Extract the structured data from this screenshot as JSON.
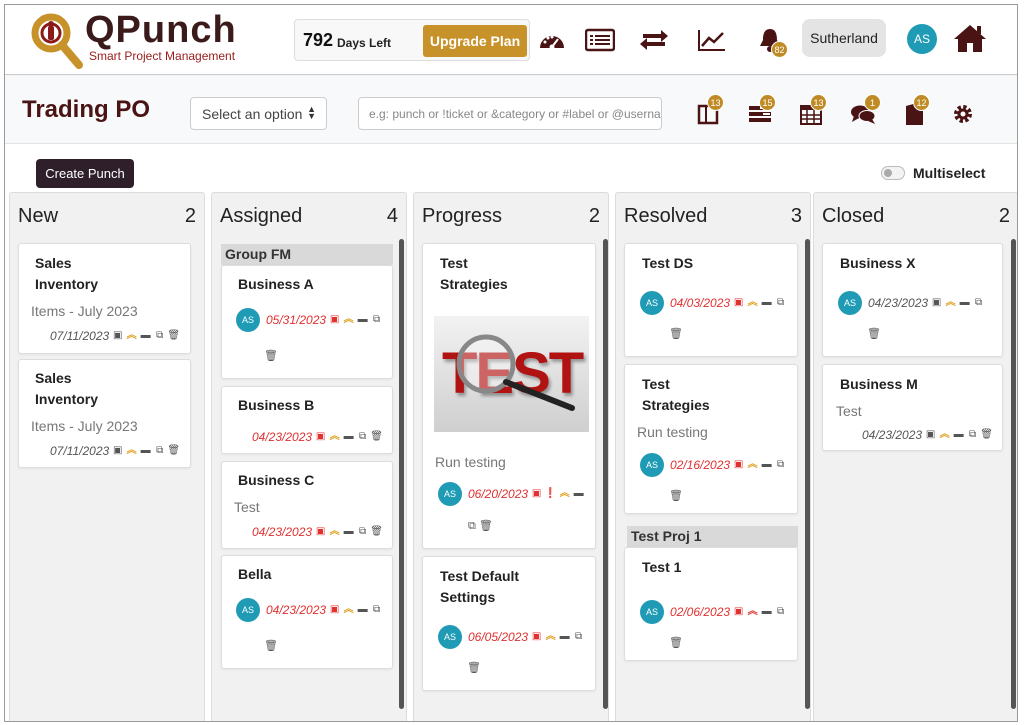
{
  "app": {
    "name": "QPunch",
    "tagline": "Smart Project Management"
  },
  "header": {
    "days_number": "792",
    "days_label": "Days Left",
    "upgrade_label": "Upgrade Plan",
    "notifications_count": "82",
    "company": "Sutherland",
    "user_initials": "AS"
  },
  "subheader": {
    "title": "Trading PO",
    "select_label": "Select an option",
    "search_placeholder": "e.g: punch or !ticket or &category or #label or @username",
    "badges": {
      "board": "13",
      "list": "15",
      "calendar": "13",
      "chat": "1",
      "book": "12"
    }
  },
  "actions": {
    "create_label": "Create Punch",
    "multiselect_label": "Multiselect"
  },
  "columns": [
    {
      "name": "New",
      "count": "2"
    },
    {
      "name": "Assigned",
      "count": "4"
    },
    {
      "name": "Progress",
      "count": "2"
    },
    {
      "name": "Resolved",
      "count": "3"
    },
    {
      "name": "Closed",
      "count": "2"
    }
  ],
  "cards": {
    "new1": {
      "title1": "Sales",
      "title2": "Inventory",
      "sub": "Items - July 2023",
      "date": "07/11/2023"
    },
    "new2": {
      "title1": "Sales",
      "title2": "Inventory",
      "sub": "Items - July 2023",
      "date": "07/11/2023"
    },
    "assigned_group": "Group FM",
    "busA": {
      "title": "Business A",
      "date": "05/31/2023",
      "avatar": "AS"
    },
    "busB": {
      "title": "Business B",
      "date": "04/23/2023"
    },
    "busC": {
      "title": "Business C",
      "sub": "Test",
      "date": "04/23/2023"
    },
    "bella": {
      "title": "Bella",
      "date": "04/23/2023",
      "avatar": "AS"
    },
    "prog1": {
      "title1": "Test",
      "title2": "Strategies",
      "image_text": "TEST",
      "sub": "Run testing",
      "date": "06/20/2023",
      "avatar": "AS"
    },
    "prog2": {
      "title1": "Test Default",
      "title2": "Settings",
      "date": "06/05/2023",
      "avatar": "AS"
    },
    "res1": {
      "title": "Test DS",
      "date": "04/03/2023",
      "avatar": "AS"
    },
    "res2": {
      "title1": "Test",
      "title2": "Strategies",
      "sub": "Run testing",
      "date": "02/16/2023",
      "avatar": "AS"
    },
    "resolved_group": "Test Proj 1",
    "res3": {
      "title": "Test 1",
      "date": "02/06/2023",
      "avatar": "AS"
    },
    "cl1": {
      "title": "Business X",
      "date": "04/23/2023",
      "avatar": "AS"
    },
    "cl2": {
      "title": "Business M",
      "sub": "Test",
      "date": "04/23/2023"
    }
  },
  "colors": {
    "brand": "#4a1414",
    "accent": "#c8922a",
    "avatar": "#1f9bb5",
    "due": "#e03030"
  }
}
